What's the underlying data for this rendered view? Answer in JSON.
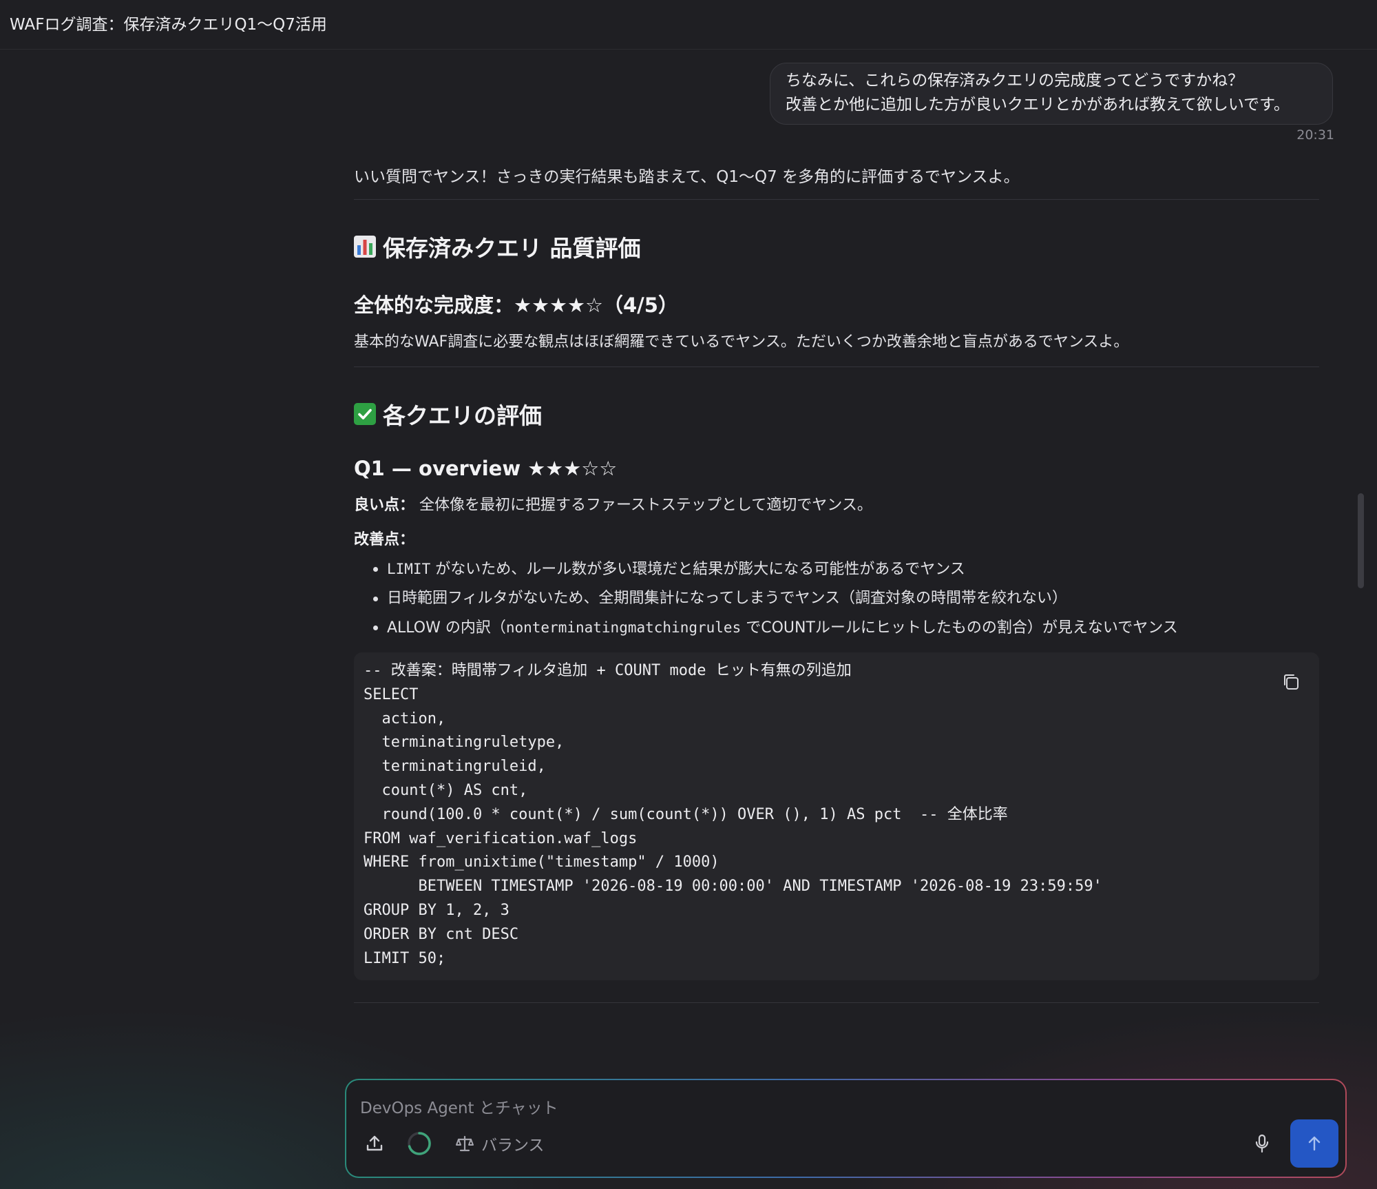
{
  "header": {
    "title": "WAFログ調査：保存済みクエリQ1〜Q7活用"
  },
  "user_message": {
    "lines": [
      "ちなみに、これらの保存済みクエリの完成度ってどうですかね？",
      "改善とか他に追加した方が良いクエリとかがあれば教えて欲しいです。"
    ],
    "time": "20:31"
  },
  "assistant": {
    "intro": "いい質問でヤンス！さっきの実行結果も踏まえて、Q1〜Q7 を多角的に評価するでヤンスよ。",
    "section1": {
      "icon": "bar-chart-icon",
      "title": "保存済みクエリ 品質評価",
      "subtitle": "全体的な完成度：★★★★☆（4/5）",
      "rating": 0.8,
      "body": "基本的なWAF調査に必要な観点はほぼ網羅できているでヤンス。ただいくつか改善余地と盲点があるでヤンスよ。"
    },
    "section2": {
      "icon": "check-mark-icon",
      "title": "各クエリの評価",
      "q1": {
        "title": "Q1 — overview ★★★☆☆",
        "rating": 0.6,
        "good_label": "良い点：",
        "good_text": "全体像を最初に把握するファーストステップとして適切でヤンス。",
        "improve_label": "改善点：",
        "bullets": [
          {
            "code": "LIMIT",
            "text": " がないため、ルール数が多い環境だと結果が膨大になる可能性があるでヤンス"
          },
          {
            "code": "",
            "text": "日時範囲フィルタがないため、全期間集計になってしまうでヤンス（調査対象の時間帯を絞れない）"
          },
          {
            "pre": "ALLOW の内訳（",
            "code": "nonterminatingmatchingrules",
            "text": " でCOUNTルールにヒットしたものの割合）が見えないでヤンス"
          }
        ],
        "code_lines": [
          "-- 改善案：時間帯フィルタ追加 + COUNT mode ヒット有無の列追加",
          "SELECT",
          "  action,",
          "  terminatingruletype,",
          "  terminatingruleid,",
          "  count(*) AS cnt,",
          "  round(100.0 * count(*) / sum(count(*)) OVER (), 1) AS pct  -- 全体比率",
          "FROM waf_verification.waf_logs",
          "WHERE from_unixtime(\"timestamp\" / 1000)",
          "      BETWEEN TIMESTAMP '2026-08-19 00:00:00' AND TIMESTAMP '2026-08-19 23:59:59'",
          "GROUP BY 1, 2, 3",
          "ORDER BY cnt DESC",
          "LIMIT 50;"
        ]
      }
    }
  },
  "composer": {
    "placeholder": "DevOps Agent とチャット",
    "mode_label": "バランス"
  },
  "colors": {
    "background": "#1f1f23",
    "send_button": "#2457c5",
    "check_icon": "#2ea043"
  }
}
